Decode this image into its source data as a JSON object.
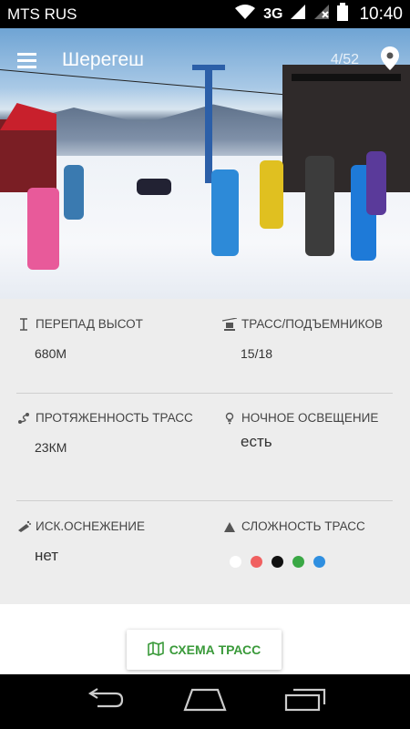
{
  "status_bar": {
    "carrier": "MTS RUS",
    "network": "3G",
    "time": "10:40"
  },
  "app_bar": {
    "title": "Шерегеш",
    "counter": "4/52"
  },
  "stats": [
    {
      "label": "ПЕРЕПАД ВЫСОТ",
      "value": "680М",
      "icon": "height-icon"
    },
    {
      "label": "ТРАСС/ПОДЪЕМНИКОВ",
      "value": "15/18",
      "icon": "lift-icon"
    },
    {
      "label": "ПРОТЯЖЕННОСТЬ ТРАСС",
      "value": "23КМ",
      "icon": "route-icon"
    },
    {
      "label": "НОЧНОЕ ОСВЕЩЕНИЕ",
      "value": "есть",
      "icon": "light-icon"
    },
    {
      "label": "ИСК.ОСНЕЖЕНИЕ",
      "value": "нет",
      "icon": "snow-cannon-icon"
    },
    {
      "label": "СЛОЖНОСТЬ ТРАСС",
      "value": "",
      "icon": "difficulty-icon"
    }
  ],
  "difficulty_colors": [
    "#ffffff",
    "#f06060",
    "#111111",
    "#3aa845",
    "#2f8fe0"
  ],
  "scheme_button": {
    "label": "СХЕМА ТРАСС",
    "color": "#3a9a3a"
  }
}
